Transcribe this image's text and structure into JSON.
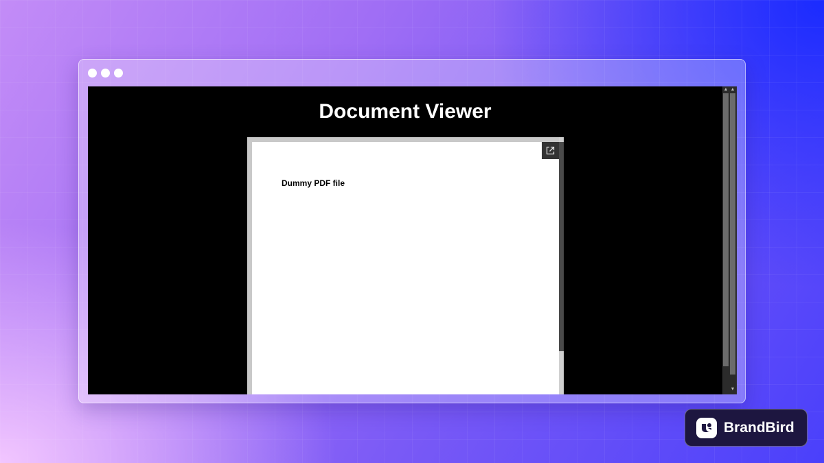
{
  "viewer": {
    "title": "Document Viewer",
    "pdf": {
      "text": "Dummy PDF file",
      "open_external_icon": "external-link-icon"
    }
  },
  "badge": {
    "name": "BrandBird",
    "logo_icon": "brandbird-logo-icon"
  },
  "window_controls": [
    "window-dot",
    "window-dot",
    "window-dot"
  ],
  "colors": {
    "viewport_background": "#000000",
    "badge_background": "#1d1640",
    "accent_blue": "#1a2bff",
    "accent_purple": "#a06ef5"
  }
}
